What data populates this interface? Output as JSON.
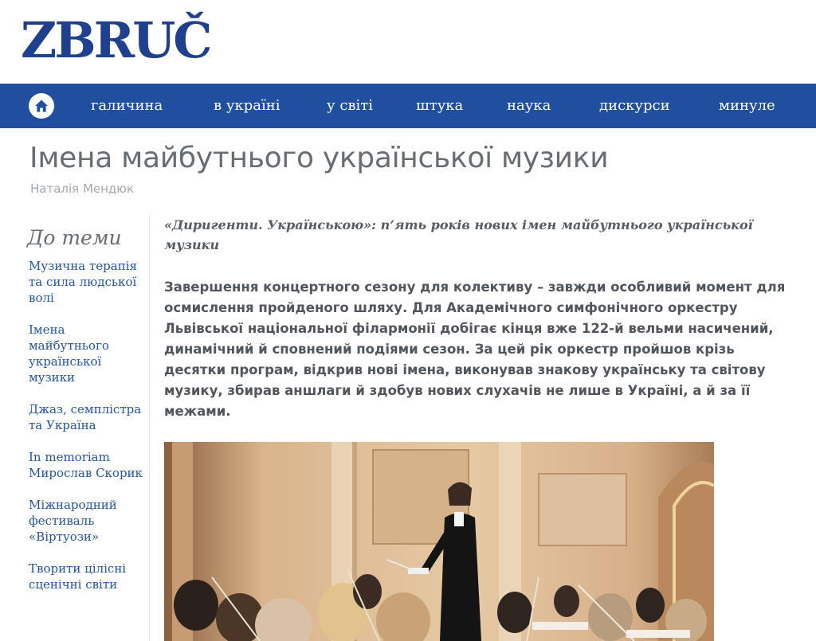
{
  "site": {
    "logo_text": "ZBRUČ"
  },
  "nav": {
    "home_icon": "home-icon",
    "items": [
      {
        "label": "галичина"
      },
      {
        "label": "в україні"
      },
      {
        "label": "у світі"
      },
      {
        "label": "штука"
      },
      {
        "label": "наука"
      },
      {
        "label": "дискурси"
      },
      {
        "label": "минуле"
      }
    ]
  },
  "article": {
    "title": "Імена майбутнього української музики",
    "author": "Наталія Мендюк",
    "lead": "«Диригенти. Українською»: п’ять років нових імен майбутнього української музики",
    "intro": "Завершення концертного сезону для колективу – завжди особливий момент для осмислення пройденого шляху. Для Академічного симфонічного оркестру Львівської національної філармонії добігає кінця вже 122-й вельми насичений, динамічний й сповнений подіями сезон. За цей рік оркестр пройшов крізь десятки програм, відкрив нові імена, виконував знакову українську та світову музику, збирав аншлаги й здобув нових слухачів не лише в Україні, а й за її межами."
  },
  "sidebar": {
    "heading": "До теми",
    "links": [
      {
        "label": "Музична терапія та сила людської волі"
      },
      {
        "label": "Імена майбутнього української музики"
      },
      {
        "label": "Джаз, семплістра та Україна"
      },
      {
        "label": "In memoriam Мирослав Скорик"
      },
      {
        "label": "Міжнародний фестиваль «Віртуози»"
      },
      {
        "label": "Творити цілісні сценічні світи"
      }
    ]
  },
  "colors": {
    "nav_bg": "#1f4f9e",
    "logo": "#1f3f8f",
    "link": "#2255a4",
    "title": "#666d73"
  }
}
